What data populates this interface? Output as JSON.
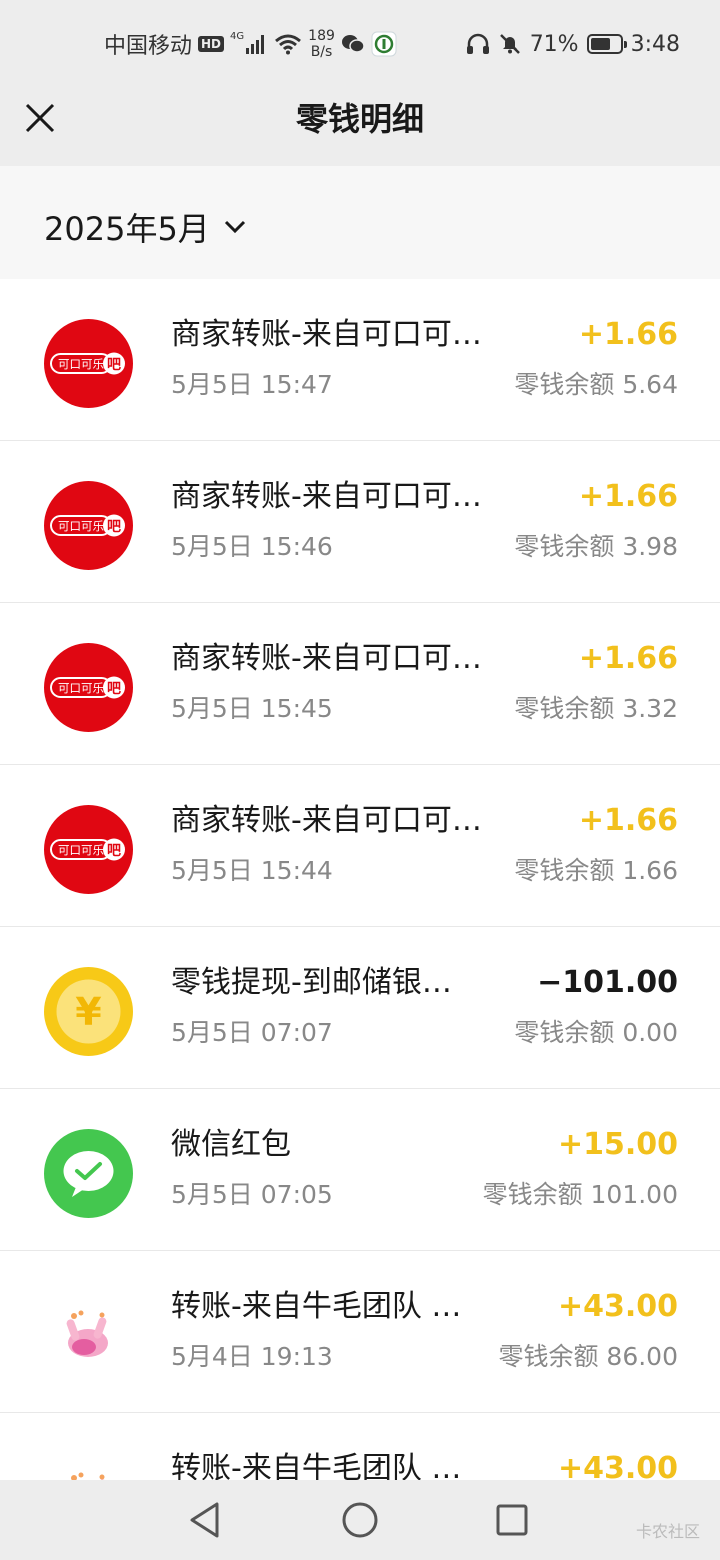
{
  "status_bar": {
    "carrier": "中国移动",
    "hd": "HD",
    "network": "4G",
    "speed_value": "189",
    "speed_unit": "B/s",
    "battery_pct": "71%",
    "battery_level": 0.71,
    "time": "3:48"
  },
  "nav": {
    "title": "零钱明细",
    "close_icon": "close-icon"
  },
  "filter": {
    "month_label": "2025年5月",
    "dropdown_icon": "chevron-down-icon"
  },
  "colors": {
    "income": "#f2c01c",
    "expense": "#191919",
    "coke_red": "#e00712",
    "coin_yellow": "#f7c917",
    "wechat_green": "#44c74f"
  },
  "transactions": [
    {
      "avatar": "coke-logo",
      "avatar_text": "可口可乐",
      "avatar_badge": "吧",
      "title": "商家转账-来自可口可…",
      "time": "5月5日 15:47",
      "amount": "+1.66",
      "balance": "零钱余额 5.64",
      "type": "income"
    },
    {
      "avatar": "coke-logo",
      "avatar_text": "可口可乐",
      "avatar_badge": "吧",
      "title": "商家转账-来自可口可…",
      "time": "5月5日 15:46",
      "amount": "+1.66",
      "balance": "零钱余额 3.98",
      "type": "income"
    },
    {
      "avatar": "coke-logo",
      "avatar_text": "可口可乐",
      "avatar_badge": "吧",
      "title": "商家转账-来自可口可…",
      "time": "5月5日 15:45",
      "amount": "+1.66",
      "balance": "零钱余额 3.32",
      "type": "income"
    },
    {
      "avatar": "coke-logo",
      "avatar_text": "可口可乐",
      "avatar_badge": "吧",
      "title": "商家转账-来自可口可…",
      "time": "5月5日 15:44",
      "amount": "+1.66",
      "balance": "零钱余额 1.66",
      "type": "income"
    },
    {
      "avatar": "yuan-coin-icon",
      "avatar_text": "¥",
      "title": "零钱提现-到邮储银…",
      "time": "5月5日 07:07",
      "amount": "−101.00",
      "balance": "零钱余额 0.00",
      "type": "expense"
    },
    {
      "avatar": "wechat-icon",
      "title": "微信红包",
      "time": "5月5日 07:05",
      "amount": "+15.00",
      "balance": "零钱余额 101.00",
      "type": "income"
    },
    {
      "avatar": "emoji-avatar",
      "title": "转账-来自牛毛团队 …",
      "time": "5月4日 19:13",
      "amount": "+43.00",
      "balance": "零钱余额 86.00",
      "type": "income"
    },
    {
      "avatar": "emoji-avatar",
      "title": "转账-来自牛毛团队 …",
      "time": "",
      "amount": "+43.00",
      "balance": "",
      "type": "income"
    }
  ],
  "system_nav": {
    "back": "back-triangle-icon",
    "home": "home-circle-icon",
    "recents": "recents-square-icon",
    "watermark": "卡农社区"
  }
}
